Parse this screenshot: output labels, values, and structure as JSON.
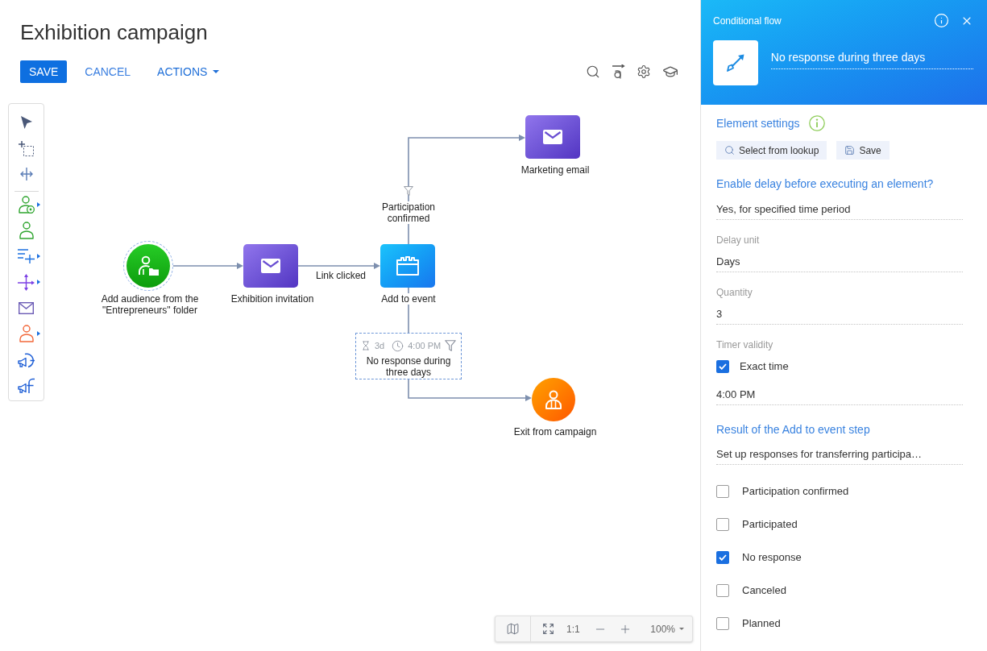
{
  "page": {
    "title": "Exhibition campaign",
    "actions": [
      {
        "kind": "primary",
        "label": "SAVE"
      },
      {
        "kind": "link",
        "label": "CANCEL"
      },
      {
        "kind": "menu",
        "label": "ACTIONS"
      }
    ]
  },
  "diagram": {
    "nodes": [
      {
        "kind": "audience",
        "label": "Add audience from the \"Entrepreneurs\" folder"
      },
      {
        "kind": "email",
        "label": "Exhibition invitation"
      },
      {
        "kind": "event",
        "label": "Add to event"
      },
      {
        "kind": "email",
        "label": "Marketing email"
      },
      {
        "kind": "exit",
        "label": "Exit from campaign"
      }
    ],
    "flows": [
      {
        "selected": false
      },
      {
        "label": "Link clicked",
        "conditional": false,
        "selected": false
      },
      {
        "label": "Participation confirmed",
        "conditional": true,
        "selected": false
      },
      {
        "label": "No response during three days",
        "conditional": true,
        "selected": true,
        "delay": "3d",
        "time": "4:00 PM"
      }
    ]
  },
  "zoom_bar": {
    "actual_size": "1:1",
    "zoom": "100%"
  },
  "panel": {
    "caption": "Conditional flow",
    "name": "No response during three days",
    "section_title": "Element settings",
    "actions": [
      {
        "kind": "lookup",
        "label": "Select from lookup"
      },
      {
        "kind": "save",
        "label": "Save"
      }
    ],
    "delay_question": "Enable delay before executing an element?",
    "delay_mode": "Yes, for specified time period",
    "fields": [
      {
        "label": "Delay unit",
        "value": "Days"
      },
      {
        "label": "Quantity",
        "value": "3"
      }
    ],
    "timer": {
      "label": "Timer validity",
      "option": {
        "label": "Exact time",
        "checked": true
      },
      "time": "4:00 PM"
    },
    "result": {
      "title": "Result of the Add to event step",
      "value": "Set up responses for transferring participa…",
      "responses": [
        {
          "label": "Participation confirmed",
          "checked": false
        },
        {
          "label": "Participated",
          "checked": false
        },
        {
          "label": "No response",
          "checked": true
        },
        {
          "label": "Canceled",
          "checked": false
        },
        {
          "label": "Planned",
          "checked": false
        }
      ]
    }
  }
}
